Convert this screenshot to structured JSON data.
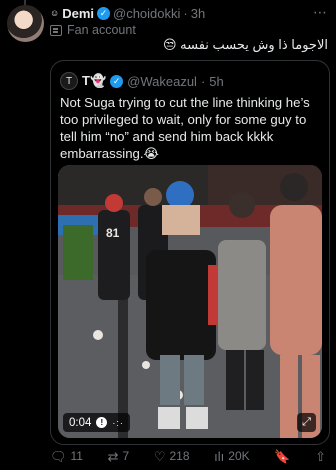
{
  "post": {
    "author_emoji": "☺",
    "author_name": "Demi",
    "handle": "@choidokki",
    "separator": "·",
    "time": "3h",
    "fan_label": "Fan account",
    "text": "الاجوما ذا وش يحسب نفسه 😒"
  },
  "quote": {
    "avatar_label": "T",
    "author_name": "T👻",
    "handle": "@Wakeazul",
    "separator": "·",
    "time": "5h",
    "text": "Not Suga trying to cut the line thinking he’s too privileged to wait, only for some guy to tell him “no” and send him back kkkk embarrassing.😭"
  },
  "video": {
    "elapsed": "0:04",
    "mute_icon": "muted-icon",
    "caption_dots": "·:·",
    "expand_icon": "expand-icon",
    "shirt_number": "81"
  },
  "actions": {
    "replies": "11",
    "reposts": "7",
    "likes": "218",
    "views": "20K"
  },
  "colors": {
    "background": "#000000",
    "text": "#e7e9ea",
    "muted": "#71767b",
    "border": "#2f3336",
    "verified": "#1d9bf0"
  }
}
